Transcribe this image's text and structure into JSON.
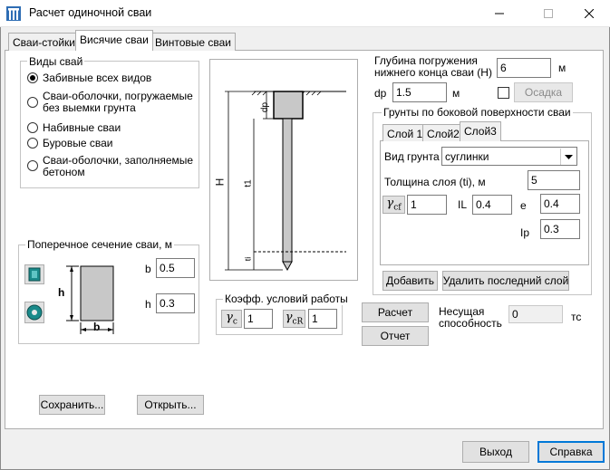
{
  "window": {
    "title": "Расчет одиночной сваи"
  },
  "tabs": [
    {
      "label": "Сваи-стойки"
    },
    {
      "label": "Висячие сваи"
    },
    {
      "label": "Винтовые сваи"
    }
  ],
  "pile_types": {
    "title": "Виды свай",
    "options": [
      {
        "label": "Забивные всех видов",
        "checked": true
      },
      {
        "label": "Сваи-оболочки, погружаемые\nбез выемки грунта"
      },
      {
        "label": "Набивные сваи"
      },
      {
        "label": "Буровые сваи"
      },
      {
        "label": "Сваи-оболочки, заполняемые\nбетоном"
      }
    ]
  },
  "cross_section": {
    "title": "Поперечное сечение сваи, м",
    "b_label": "b",
    "b_value": "0.5",
    "h_label": "h",
    "h_value": "0.3",
    "diagram_h": "h",
    "diagram_b": "b"
  },
  "diagram": {
    "dp": "dp",
    "H": "H",
    "t1": "t1",
    "ti": "ti"
  },
  "coeff": {
    "title": "Коэфф. условий работы",
    "gc_value": "1",
    "gcr_value": "1"
  },
  "depth": {
    "label": "Глубина погружения\nнижнего конца сваи (H)",
    "value": "6",
    "unit": "м",
    "dp_label": "dp",
    "dp_value": "1.5",
    "dp_unit": "м",
    "settle_button": "Осадка"
  },
  "soils": {
    "title": "Грунты по боковой поверхности сваи",
    "layer_tabs": [
      {
        "label": "Слой 1"
      },
      {
        "label": "Слой2"
      },
      {
        "label": "Слой3"
      }
    ],
    "soil_type_label": "Вид грунта",
    "soil_type_value": "суглинки",
    "thickness_label": "Толщина слоя (ti), м",
    "thickness_value": "5",
    "gcf_value": "1",
    "il_label": "IL",
    "il_value": "0.4",
    "e_label": "e",
    "e_value": "0.4",
    "ip_label": "Ip",
    "ip_value": "0.3",
    "add_button": "Добавить",
    "delete_button": "Удалить последний слой"
  },
  "calc": {
    "calc_button": "Расчет",
    "report_button": "Отчет",
    "capacity_label": "Несущая\nспособность",
    "capacity_value": "0",
    "capacity_unit": "тс"
  },
  "file": {
    "save_button": "Сохранить...",
    "open_button": "Открыть..."
  },
  "footer": {
    "exit_button": "Выход",
    "help_button": "Справка"
  },
  "colors": {
    "accent": "#0078d7",
    "rect_section": "#1a8a8a",
    "pile_fill": "#c8c8c8"
  }
}
